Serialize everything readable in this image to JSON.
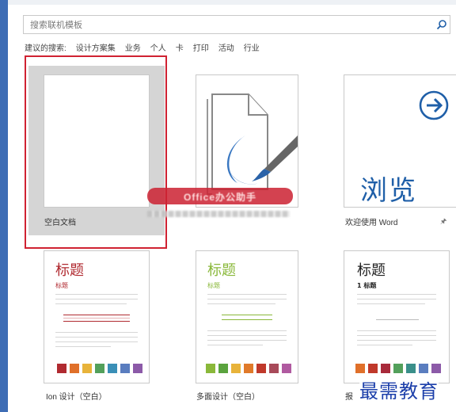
{
  "search": {
    "placeholder": "搜索联机模板"
  },
  "suggested": {
    "label": "建议的搜索:",
    "items": [
      "设计方案集",
      "业务",
      "个人",
      "卡",
      "打印",
      "活动",
      "行业"
    ]
  },
  "templates": [
    {
      "name": "空白文档"
    },
    {
      "name": ""
    },
    {
      "name": "欢迎使用 Word",
      "big_text": "浏览"
    },
    {
      "name": "Ion 设计（空白）",
      "title": "标题",
      "subtitle": "标题",
      "accent": "#b02a30",
      "swatches": [
        "#b02a30",
        "#e0702a",
        "#e8b33a",
        "#53a05b",
        "#3a8fb7",
        "#5a7dbf",
        "#8c5aa8"
      ]
    },
    {
      "name": "多面设计（空白）",
      "title": "标题",
      "subtitle": "标题",
      "accent": "#8ab83a",
      "swatches": [
        "#8ab83a",
        "#5aa33e",
        "#e8b33a",
        "#e07a2a",
        "#c0392b",
        "#a84a5a",
        "#b05aa0"
      ]
    },
    {
      "name": "报",
      "title": "标题",
      "subtitle": "1  标题",
      "accent": "#222222",
      "swatches": [
        "#e0702a",
        "#c0392b",
        "#a82a3a",
        "#53a05b",
        "#3a8f8a",
        "#5a7dbf",
        "#8c5aa8"
      ]
    }
  ],
  "watermark": {
    "text": "Office办公助手"
  },
  "brand": "最需教育"
}
